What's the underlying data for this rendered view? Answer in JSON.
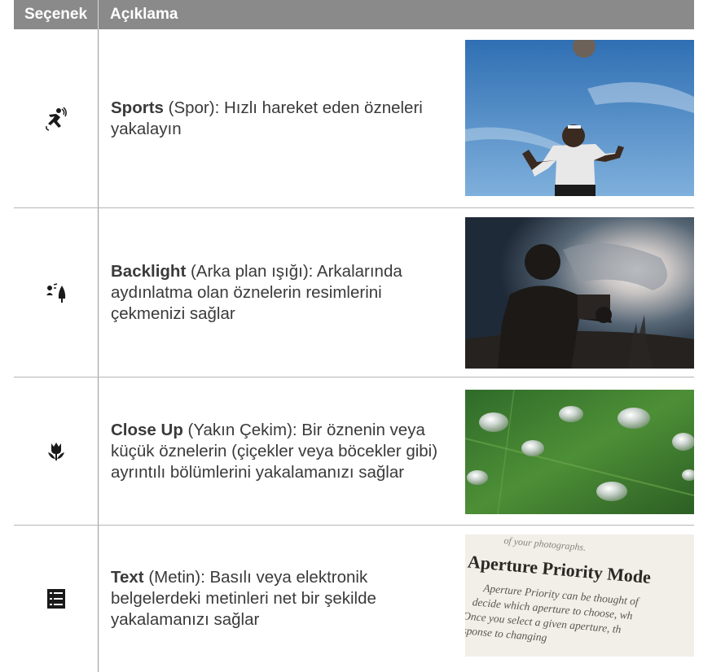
{
  "table": {
    "header": {
      "option": "Seçenek",
      "description": "Açıklama"
    },
    "rows": [
      {
        "icon": "sports-scene-icon",
        "title": "Sports",
        "text": " (Spor): Hızlı hareket eden özneleri yakalayın",
        "image": "soccer-player-photo"
      },
      {
        "icon": "backlight-scene-icon",
        "title": "Backlight",
        "text": " (Arka plan ışığı): Arkalarında aydınlatma olan öznelerin resimlerini çekmenizi sağlar",
        "image": "backlit-silhouette-photo"
      },
      {
        "icon": "close-up-flower-icon",
        "title": "Close Up",
        "text": " (Yakın Çekim): Bir öznenin veya küçük öznelerin (çiçekler veya böcekler gibi) ayrıntılı bölümlerini yakalamanızı sağlar",
        "image": "water-drops-leaf-photo"
      },
      {
        "icon": "text-document-icon",
        "title": "Text",
        "text": " (Metin): Basılı veya elektronik belgelerdeki metinleri net bir şekilde yakalamanızı sağlar",
        "image": "book-page-photo"
      }
    ],
    "book_photo_text": {
      "top_line": "of your photographs.",
      "heading": "Aperture Priority Mode",
      "body_lines": [
        "Aperture Priority can be thought of",
        "decide which aperture to choose, wh",
        "Once you select a given aperture, th",
        "response to changing"
      ]
    }
  }
}
